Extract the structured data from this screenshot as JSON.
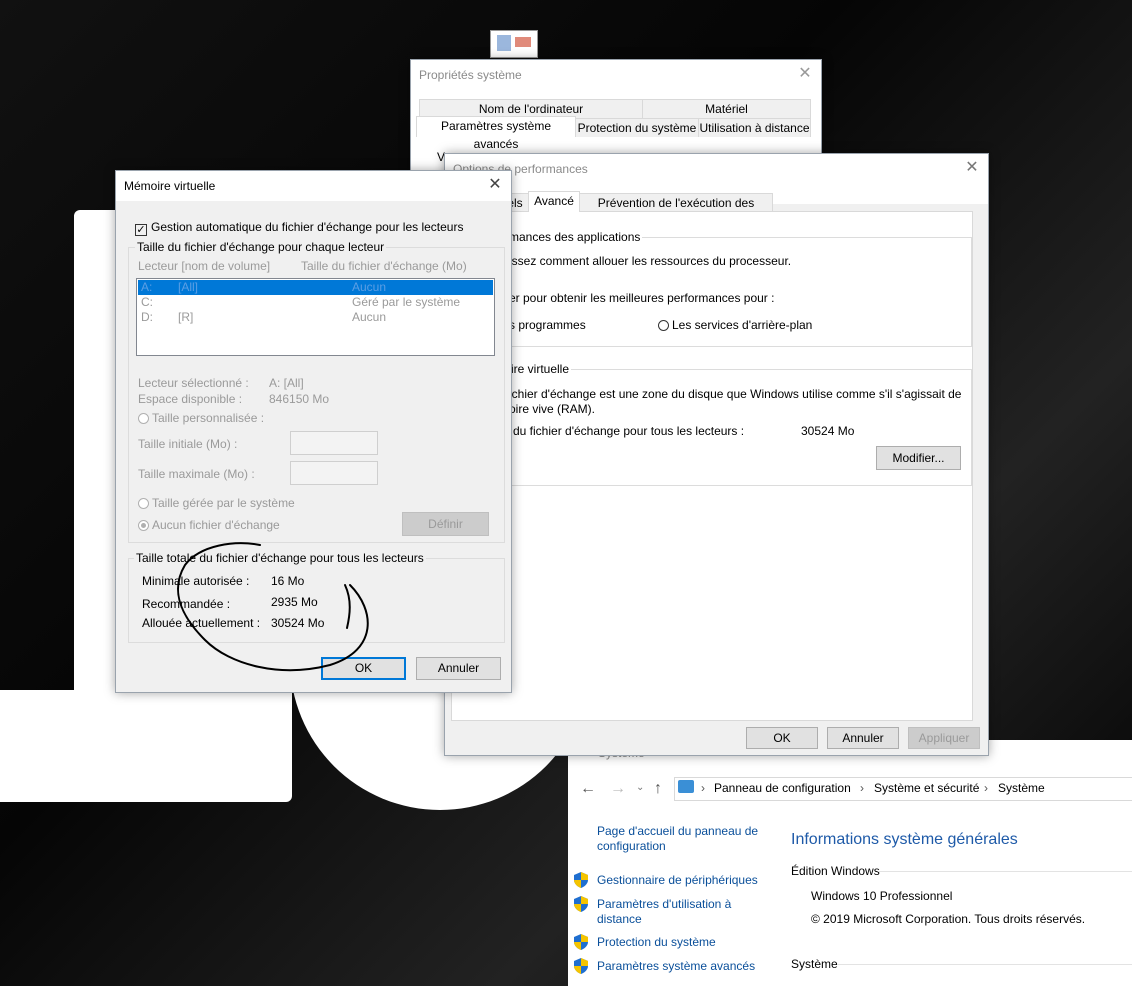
{
  "sys_props": {
    "title": "Propriétés système",
    "tabs_row1": [
      "Nom de l'ordinateur",
      "Matériel"
    ],
    "tabs_row2": [
      "Paramètres système avancés",
      "Protection du système",
      "Utilisation à distance"
    ],
    "peek_text": "Vo"
  },
  "perf": {
    "title": "Options de performances",
    "tabs": [
      "els",
      "Avancé",
      "Prévention de l'exécution des données"
    ],
    "sched_group": "mances des applications",
    "sched_line1": "issez comment allouer les ressources du processeur.",
    "sched_line2": "er pour obtenir les meilleures performances pour :",
    "sched_opt1": "s programmes",
    "sched_opt2": "Les services d'arrière-plan",
    "vm_group": "ire virtuelle",
    "vm_desc1": "ichier d'échange est une zone du disque que Windows utilise comme s'il s'agissait de",
    "vm_desc2": "oire vive (RAM).",
    "vm_total_label": "du fichier d'échange pour tous les lecteurs :",
    "vm_total_value": "30524 Mo",
    "modify": "Modifier...",
    "ok": "OK",
    "cancel": "Annuler",
    "apply": "Appliquer"
  },
  "vm": {
    "title": "Mémoire virtuelle",
    "auto_label": "Gestion automatique du fichier d'échange pour les lecteurs",
    "auto_checked": true,
    "per_drive_group": "Taille du fichier d'échange pour chaque lecteur",
    "col_drive": "Lecteur [nom de volume]",
    "col_size": "Taille du fichier d'échange (Mo)",
    "drives": [
      {
        "letter": "A:",
        "name": "[All]",
        "size": "Aucun",
        "selected": true
      },
      {
        "letter": "C:",
        "name": "",
        "size": "Géré par le système",
        "selected": false
      },
      {
        "letter": "D:",
        "name": "[R]",
        "size": "Aucun",
        "selected": false
      }
    ],
    "selected_drive_label": "Lecteur sélectionné :",
    "selected_drive_value": "A:  [All]",
    "space_label": "Espace disponible :",
    "space_value": "846150 Mo",
    "custom_size": "Taille personnalisée :",
    "initial_size": "Taille initiale (Mo) :",
    "max_size": "Taille maximale (Mo) :",
    "system_managed": "Taille gérée par le système",
    "no_paging": "Aucun fichier d'échange",
    "set_button": "Définir",
    "total_group": "Taille totale du fichier d'échange pour tous les lecteurs",
    "min_label": "Minimale autorisée :",
    "min_value": "16 Mo",
    "rec_label": "Recommandée :",
    "rec_value": "2935 Mo",
    "alloc_label": "Allouée actuellement :",
    "alloc_value": "30524 Mo",
    "ok": "OK",
    "cancel": "Annuler"
  },
  "control_panel": {
    "hidden_title": "Système",
    "breadcrumb": [
      "Panneau de configuration",
      "Système et sécurité",
      "Système"
    ],
    "home_link": "Page d'accueil du panneau de configuration",
    "links": [
      "Gestionnaire de périphériques",
      "Paramètres d'utilisation à distance",
      "Protection du système",
      "Paramètres système avancés"
    ],
    "heading": "Informations système générales",
    "edition_label": "Édition Windows",
    "edition": "Windows 10 Professionnel",
    "copyright": "© 2019 Microsoft Corporation. Tous droits réservés.",
    "system_label": "Système",
    "accent": "#1e5aa8"
  },
  "annotation_color": "#000000"
}
